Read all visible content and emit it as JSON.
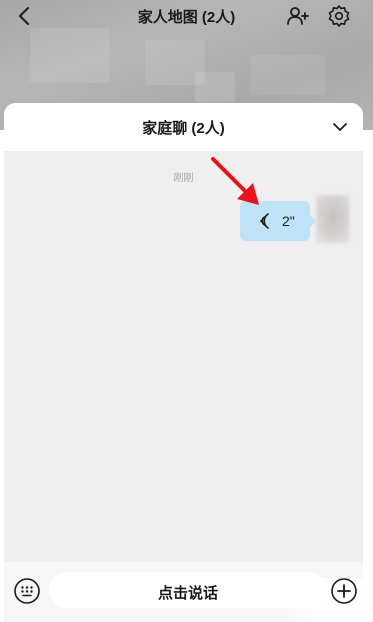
{
  "header": {
    "title": "家人地图 (2人)",
    "back_icon": "chevron-left-icon",
    "add_user_icon": "add-user-icon",
    "settings_icon": "gear-icon"
  },
  "chat_sheet": {
    "title": "家庭聊 (2人)",
    "collapse_icon": "chevron-down-icon",
    "messages": [
      {
        "timestamp": "刚刚",
        "type": "voice",
        "duration": "2\"",
        "voice_icon": "voice-wave-icon",
        "bubble_color": "#bfe2f7",
        "annotation_icon": "red-arrow-icon"
      }
    ]
  },
  "input_bar": {
    "keyboard_icon": "keyboard-icon",
    "hold_to_talk_label": "点击说话",
    "plus_icon": "plus-icon"
  },
  "colors": {
    "map_background": "#adadad",
    "sheet_background": "#efefef",
    "voice_bubble": "#bfe2f7",
    "annotation_arrow": "#e8131b"
  }
}
